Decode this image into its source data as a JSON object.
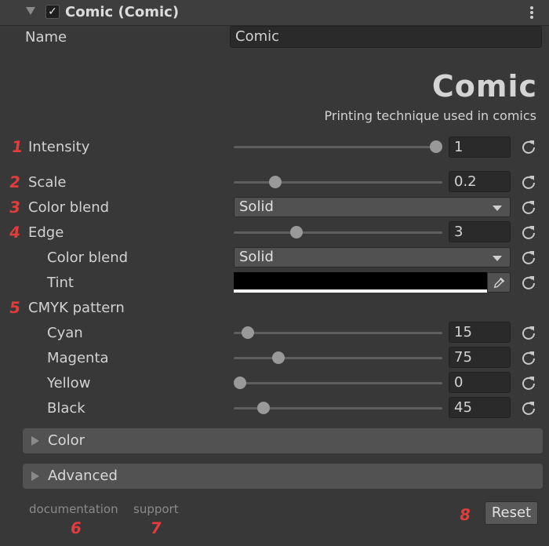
{
  "header": {
    "checkbox_mark": "✓",
    "title": "Comic (Comic)"
  },
  "name_field": {
    "label": "Name",
    "value": "Comic"
  },
  "effect_header": {
    "title": "Comic",
    "subtitle": "Printing technique used in comics"
  },
  "badges": [
    "1",
    "2",
    "3",
    "4",
    "5",
    "6",
    "7",
    "8"
  ],
  "properties": {
    "intensity": {
      "label": "Intensity",
      "value": "1",
      "fraction": 1.0
    },
    "scale": {
      "label": "Scale",
      "value": "0.2",
      "fraction": 0.2
    },
    "color_blend": {
      "label": "Color blend",
      "value": "Solid"
    },
    "edge": {
      "label": "Edge",
      "value": "3",
      "fraction": 0.3
    },
    "edge_color_blend": {
      "label": "Color blend",
      "value": "Solid"
    },
    "tint": {
      "label": "Tint",
      "color": "#000000"
    },
    "cmyk_pattern": {
      "label": "CMYK pattern"
    },
    "cyan": {
      "label": "Cyan",
      "value": "15",
      "fraction": 0.04
    },
    "magenta": {
      "label": "Magenta",
      "value": "75",
      "fraction": 0.19
    },
    "yellow": {
      "label": "Yellow",
      "value": "0",
      "fraction": 0.0
    },
    "black": {
      "label": "Black",
      "value": "45",
      "fraction": 0.115
    }
  },
  "sections": {
    "color": "Color",
    "advanced": "Advanced"
  },
  "footer": {
    "documentation": "documentation",
    "support": "support",
    "reset": "Reset"
  },
  "colors": {
    "background": "#383838",
    "badge_red": "#e23c3c",
    "slider_thumb": "#999999"
  }
}
